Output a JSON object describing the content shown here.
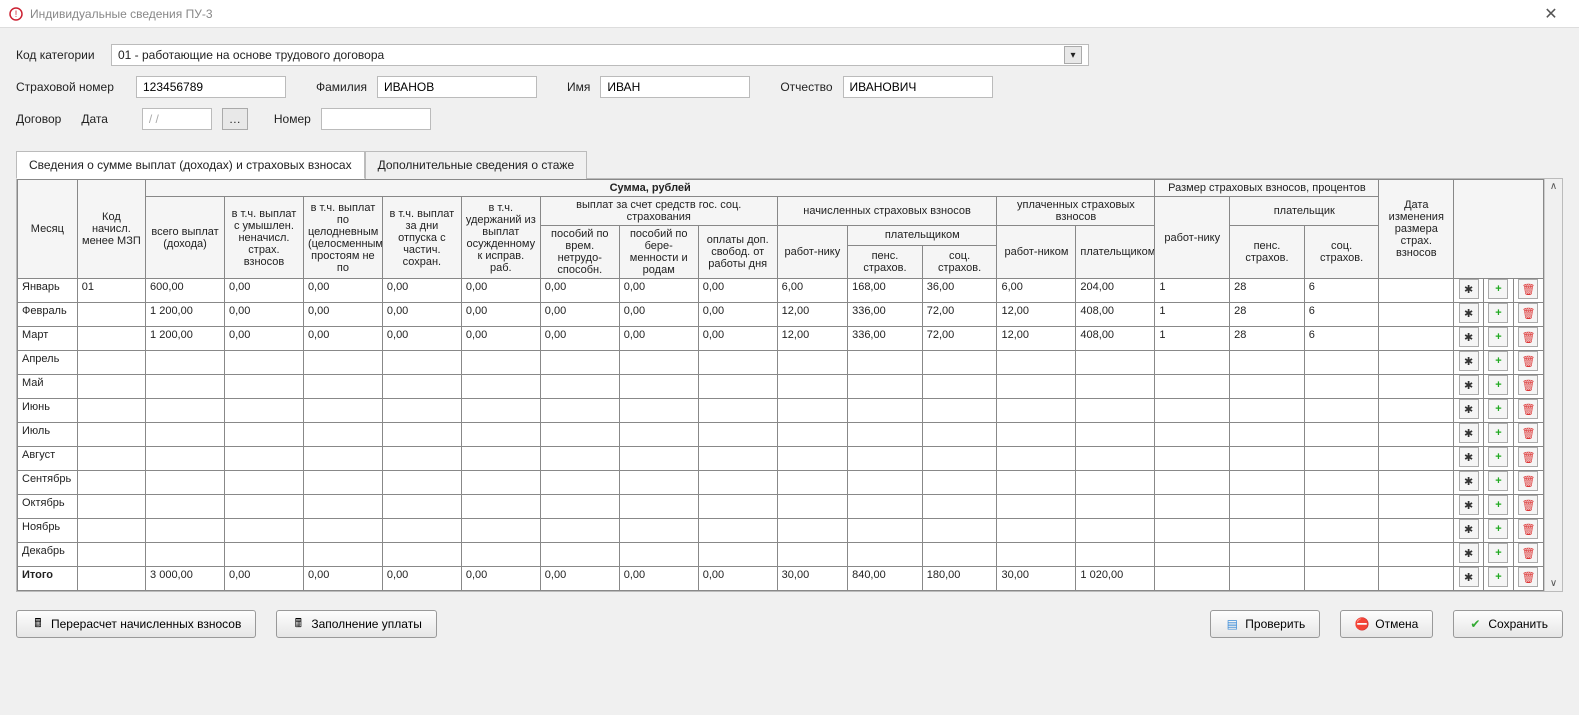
{
  "window": {
    "title": "Индивидуальные сведения ПУ-3"
  },
  "form": {
    "category_label": "Код категории",
    "category_value": "01 - работающие на основе трудового договора",
    "ins_num_label": "Страховой номер",
    "ins_num_value": "123456789",
    "lastname_label": "Фамилия",
    "lastname_value": "ИВАНОВ",
    "firstname_label": "Имя",
    "firstname_value": "ИВАН",
    "patronymic_label": "Отчество",
    "patronymic_value": "ИВАНОВИЧ",
    "contract_label": "Договор",
    "date_label": "Дата",
    "date_value": "/ /",
    "number_label": "Номер",
    "number_value": ""
  },
  "tabs": {
    "tab1": "Сведения о сумме выплат (доходах) и страховых взносах",
    "tab2": "Дополнительные сведения о стаже"
  },
  "headers": {
    "month": "Месяц",
    "code": "Код начисл. менее МЗП",
    "sum": "Сумма, рублей",
    "rate": "Размер страховых взносов, процентов",
    "date_change": "Дата изменения размера страх. взносов",
    "total_pay": "всего выплат (дохода)",
    "unacc": "в т.ч. выплат с умышлен. неначисл. страх. взносов",
    "downtime": "в т.ч. выплат по целодневным (целосменным) простоям не по",
    "vacation": "в т.ч. выплат за дни отпуска с частич. сохран.",
    "deducted": "в т.ч. удержаний из выплат осужденному к исправ. раб.",
    "gos": "выплат за счет средств гос. соц. страхования",
    "accrued": "начисленных страховых взносов",
    "paid": "уплаченных страховых взносов",
    "worker": "работ-нику",
    "payer": "плательщиком",
    "payer2": "плательщик",
    "sick": "пособий по врем. нетрудо-способн.",
    "maternity": "пособий по бере-менности и родам",
    "extra_day": "оплаты доп. свобод. от работы дня",
    "pens": "пенс. страхов.",
    "soc": "соц. страхов.",
    "worker2": "работ-ником",
    "payer3": "плательщиком"
  },
  "rows": [
    {
      "month": "Январь",
      "code": "01",
      "total": "600,00",
      "unacc": "0,00",
      "downtime": "0,00",
      "vacation": "0,00",
      "deducted": "0,00",
      "sick": "0,00",
      "maternity": "0,00",
      "extra": "0,00",
      "acc_worker": "6,00",
      "acc_pens": "168,00",
      "acc_soc": "36,00",
      "paid_worker": "6,00",
      "paid_payer": "204,00",
      "rate_worker": "1",
      "rate_pens": "28",
      "rate_soc": "6",
      "date_ch": ""
    },
    {
      "month": "Февраль",
      "code": "",
      "total": "1 200,00",
      "unacc": "0,00",
      "downtime": "0,00",
      "vacation": "0,00",
      "deducted": "0,00",
      "sick": "0,00",
      "maternity": "0,00",
      "extra": "0,00",
      "acc_worker": "12,00",
      "acc_pens": "336,00",
      "acc_soc": "72,00",
      "paid_worker": "12,00",
      "paid_payer": "408,00",
      "rate_worker": "1",
      "rate_pens": "28",
      "rate_soc": "6",
      "date_ch": ""
    },
    {
      "month": "Март",
      "code": "",
      "total": "1 200,00",
      "unacc": "0,00",
      "downtime": "0,00",
      "vacation": "0,00",
      "deducted": "0,00",
      "sick": "0,00",
      "maternity": "0,00",
      "extra": "0,00",
      "acc_worker": "12,00",
      "acc_pens": "336,00",
      "acc_soc": "72,00",
      "paid_worker": "12,00",
      "paid_payer": "408,00",
      "rate_worker": "1",
      "rate_pens": "28",
      "rate_soc": "6",
      "date_ch": ""
    },
    {
      "month": "Апрель",
      "code": "",
      "total": "",
      "unacc": "",
      "downtime": "",
      "vacation": "",
      "deducted": "",
      "sick": "",
      "maternity": "",
      "extra": "",
      "acc_worker": "",
      "acc_pens": "",
      "acc_soc": "",
      "paid_worker": "",
      "paid_payer": "",
      "rate_worker": "",
      "rate_pens": "",
      "rate_soc": "",
      "date_ch": ""
    },
    {
      "month": "Май",
      "code": "",
      "total": "",
      "unacc": "",
      "downtime": "",
      "vacation": "",
      "deducted": "",
      "sick": "",
      "maternity": "",
      "extra": "",
      "acc_worker": "",
      "acc_pens": "",
      "acc_soc": "",
      "paid_worker": "",
      "paid_payer": "",
      "rate_worker": "",
      "rate_pens": "",
      "rate_soc": "",
      "date_ch": ""
    },
    {
      "month": "Июнь",
      "code": "",
      "total": "",
      "unacc": "",
      "downtime": "",
      "vacation": "",
      "deducted": "",
      "sick": "",
      "maternity": "",
      "extra": "",
      "acc_worker": "",
      "acc_pens": "",
      "acc_soc": "",
      "paid_worker": "",
      "paid_payer": "",
      "rate_worker": "",
      "rate_pens": "",
      "rate_soc": "",
      "date_ch": ""
    },
    {
      "month": "Июль",
      "code": "",
      "total": "",
      "unacc": "",
      "downtime": "",
      "vacation": "",
      "deducted": "",
      "sick": "",
      "maternity": "",
      "extra": "",
      "acc_worker": "",
      "acc_pens": "",
      "acc_soc": "",
      "paid_worker": "",
      "paid_payer": "",
      "rate_worker": "",
      "rate_pens": "",
      "rate_soc": "",
      "date_ch": ""
    },
    {
      "month": "Август",
      "code": "",
      "total": "",
      "unacc": "",
      "downtime": "",
      "vacation": "",
      "deducted": "",
      "sick": "",
      "maternity": "",
      "extra": "",
      "acc_worker": "",
      "acc_pens": "",
      "acc_soc": "",
      "paid_worker": "",
      "paid_payer": "",
      "rate_worker": "",
      "rate_pens": "",
      "rate_soc": "",
      "date_ch": ""
    },
    {
      "month": "Сентябрь",
      "code": "",
      "total": "",
      "unacc": "",
      "downtime": "",
      "vacation": "",
      "deducted": "",
      "sick": "",
      "maternity": "",
      "extra": "",
      "acc_worker": "",
      "acc_pens": "",
      "acc_soc": "",
      "paid_worker": "",
      "paid_payer": "",
      "rate_worker": "",
      "rate_pens": "",
      "rate_soc": "",
      "date_ch": ""
    },
    {
      "month": "Октябрь",
      "code": "",
      "total": "",
      "unacc": "",
      "downtime": "",
      "vacation": "",
      "deducted": "",
      "sick": "",
      "maternity": "",
      "extra": "",
      "acc_worker": "",
      "acc_pens": "",
      "acc_soc": "",
      "paid_worker": "",
      "paid_payer": "",
      "rate_worker": "",
      "rate_pens": "",
      "rate_soc": "",
      "date_ch": ""
    },
    {
      "month": "Ноябрь",
      "code": "",
      "total": "",
      "unacc": "",
      "downtime": "",
      "vacation": "",
      "deducted": "",
      "sick": "",
      "maternity": "",
      "extra": "",
      "acc_worker": "",
      "acc_pens": "",
      "acc_soc": "",
      "paid_worker": "",
      "paid_payer": "",
      "rate_worker": "",
      "rate_pens": "",
      "rate_soc": "",
      "date_ch": ""
    },
    {
      "month": "Декабрь",
      "code": "",
      "total": "",
      "unacc": "",
      "downtime": "",
      "vacation": "",
      "deducted": "",
      "sick": "",
      "maternity": "",
      "extra": "",
      "acc_worker": "",
      "acc_pens": "",
      "acc_soc": "",
      "paid_worker": "",
      "paid_payer": "",
      "rate_worker": "",
      "rate_pens": "",
      "rate_soc": "",
      "date_ch": ""
    }
  ],
  "totals": {
    "month": "Итого",
    "code": "",
    "total": "3 000,00",
    "unacc": "0,00",
    "downtime": "0,00",
    "vacation": "0,00",
    "deducted": "0,00",
    "sick": "0,00",
    "maternity": "0,00",
    "extra": "0,00",
    "acc_worker": "30,00",
    "acc_pens": "840,00",
    "acc_soc": "180,00",
    "paid_worker": "30,00",
    "paid_payer": "1 020,00",
    "rate_worker": "",
    "rate_pens": "",
    "rate_soc": "",
    "date_ch": ""
  },
  "footer": {
    "recalc": "Перерасчет начисленных взносов",
    "fill": "Заполнение уплаты",
    "check": "Проверить",
    "cancel": "Отмена",
    "save": "Сохранить"
  }
}
